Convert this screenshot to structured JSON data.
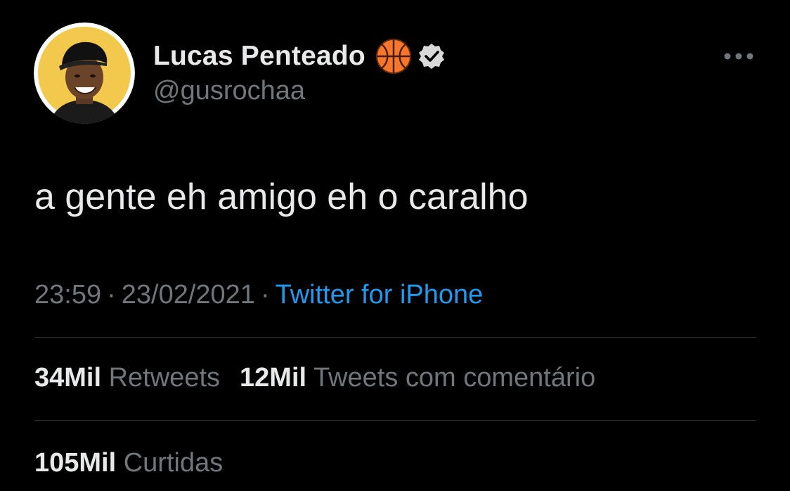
{
  "tweet": {
    "author": {
      "display_name": "Lucas Penteado",
      "handle": "@gusrochaa",
      "name_emoji": "basketball-icon",
      "verified_icon": "verified-badge-icon",
      "avatar_icon": "avatar"
    },
    "text": "a gente eh amigo eh o caralho",
    "meta": {
      "time": "23:59",
      "separator": "·",
      "date": "23/02/2021",
      "source": "Twitter for iPhone"
    },
    "stats": {
      "retweets_count": "34Mil",
      "retweets_label": "Retweets",
      "quotes_count": "12Mil",
      "quotes_label": "Tweets com comentário",
      "likes_count": "105Mil",
      "likes_label": "Curtidas"
    },
    "more_icon": "more-options-icon"
  },
  "colors": {
    "background": "#000000",
    "primary_text": "#e7e9ea",
    "secondary_text": "#71767b",
    "link": "#1d9bf0",
    "divider": "#2f3336",
    "avatar_bg": "#f2c94c"
  }
}
